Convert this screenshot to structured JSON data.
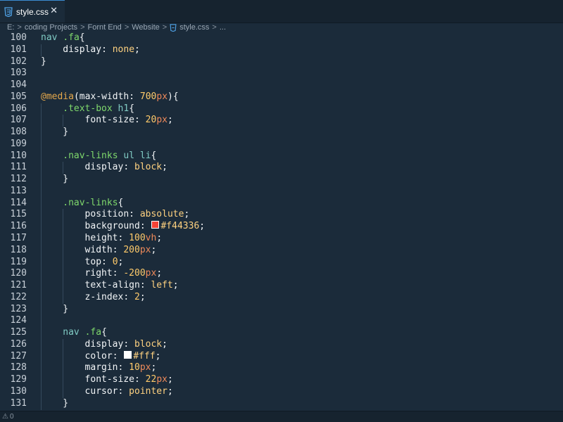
{
  "tab": {
    "label": "style.css",
    "close_glyph": "✕",
    "icon": "css3-icon"
  },
  "breadcrumb": {
    "items": [
      "E:",
      "coding Projects",
      "Fornt End",
      "Website",
      "style.css",
      "..."
    ],
    "separator": ">"
  },
  "status": {
    "problems_icon": "⚠",
    "count": "0"
  },
  "colors": {
    "background": "#1b2b3a",
    "tab_accent": "#3b8bd1",
    "swatch_red": "#f44336",
    "swatch_white": "#fff"
  },
  "code": {
    "lines": [
      {
        "n": "100",
        "i": 0,
        "t": [
          [
            "nav ",
            "sel"
          ],
          [
            ".fa",
            "cls"
          ],
          [
            "{",
            "punc"
          ]
        ]
      },
      {
        "n": "101",
        "i": 1,
        "t": [
          [
            "display",
            "prop"
          ],
          [
            ": ",
            "punc"
          ],
          [
            "none",
            "val"
          ],
          [
            ";",
            "punc"
          ]
        ]
      },
      {
        "n": "102",
        "i": 0,
        "t": [
          [
            "}",
            "punc"
          ]
        ]
      },
      {
        "n": "103",
        "i": 0,
        "t": []
      },
      {
        "n": "104",
        "i": 0,
        "t": []
      },
      {
        "n": "105",
        "i": 0,
        "t": [
          [
            "@media",
            "at"
          ],
          [
            "(",
            "punc"
          ],
          [
            "max-width",
            "prop"
          ],
          [
            ": ",
            "punc"
          ],
          [
            "700",
            "num"
          ],
          [
            "px",
            "unit"
          ],
          [
            "){",
            "punc"
          ]
        ]
      },
      {
        "n": "106",
        "i": 1,
        "t": [
          [
            ".text-box",
            "cls"
          ],
          [
            " h1",
            "sel"
          ],
          [
            "{",
            "punc"
          ]
        ]
      },
      {
        "n": "107",
        "i": 2,
        "t": [
          [
            "font-size",
            "prop"
          ],
          [
            ": ",
            "punc"
          ],
          [
            "20",
            "num"
          ],
          [
            "px",
            "unit"
          ],
          [
            ";",
            "punc"
          ]
        ]
      },
      {
        "n": "108",
        "i": 1,
        "t": [
          [
            "}",
            "punc"
          ]
        ]
      },
      {
        "n": "109",
        "i": 1,
        "t": []
      },
      {
        "n": "110",
        "i": 1,
        "t": [
          [
            ".nav-links",
            "cls"
          ],
          [
            " ul li",
            "sel"
          ],
          [
            "{",
            "punc"
          ]
        ]
      },
      {
        "n": "111",
        "i": 2,
        "t": [
          [
            "display",
            "prop"
          ],
          [
            ": ",
            "punc"
          ],
          [
            "block",
            "val"
          ],
          [
            ";",
            "punc"
          ]
        ]
      },
      {
        "n": "112",
        "i": 1,
        "t": [
          [
            "}",
            "punc"
          ]
        ]
      },
      {
        "n": "113",
        "i": 1,
        "t": []
      },
      {
        "n": "114",
        "i": 1,
        "t": [
          [
            ".nav-links",
            "cls"
          ],
          [
            "{",
            "punc"
          ]
        ]
      },
      {
        "n": "115",
        "i": 2,
        "t": [
          [
            "position",
            "prop"
          ],
          [
            ": ",
            "punc"
          ],
          [
            "absolute",
            "val"
          ],
          [
            ";",
            "punc"
          ]
        ]
      },
      {
        "n": "116",
        "i": 2,
        "t": [
          [
            "background",
            "prop"
          ],
          [
            ": ",
            "punc"
          ],
          [
            "#f44336",
            "swatch"
          ],
          [
            "#f44336",
            "val"
          ],
          [
            ";",
            "punc"
          ]
        ]
      },
      {
        "n": "117",
        "i": 2,
        "t": [
          [
            "height",
            "prop"
          ],
          [
            ": ",
            "punc"
          ],
          [
            "100",
            "num"
          ],
          [
            "vh",
            "unit"
          ],
          [
            ";",
            "punc"
          ]
        ]
      },
      {
        "n": "118",
        "i": 2,
        "t": [
          [
            "width",
            "prop"
          ],
          [
            ": ",
            "punc"
          ],
          [
            "200",
            "num"
          ],
          [
            "px",
            "unit"
          ],
          [
            ";",
            "punc"
          ]
        ]
      },
      {
        "n": "119",
        "i": 2,
        "t": [
          [
            "top",
            "prop"
          ],
          [
            ": ",
            "punc"
          ],
          [
            "0",
            "num"
          ],
          [
            ";",
            "punc"
          ]
        ]
      },
      {
        "n": "120",
        "i": 2,
        "t": [
          [
            "right",
            "prop"
          ],
          [
            ": ",
            "punc"
          ],
          [
            "-200",
            "num"
          ],
          [
            "px",
            "unit"
          ],
          [
            ";",
            "punc"
          ]
        ]
      },
      {
        "n": "121",
        "i": 2,
        "t": [
          [
            "text-align",
            "prop"
          ],
          [
            ": ",
            "punc"
          ],
          [
            "left",
            "val"
          ],
          [
            ";",
            "punc"
          ]
        ]
      },
      {
        "n": "122",
        "i": 2,
        "t": [
          [
            "z-index",
            "prop"
          ],
          [
            ": ",
            "punc"
          ],
          [
            "2",
            "num"
          ],
          [
            ";",
            "punc"
          ]
        ]
      },
      {
        "n": "123",
        "i": 1,
        "t": [
          [
            "}",
            "punc"
          ]
        ]
      },
      {
        "n": "124",
        "i": 1,
        "t": []
      },
      {
        "n": "125",
        "i": 1,
        "t": [
          [
            "nav ",
            "sel"
          ],
          [
            ".fa",
            "cls"
          ],
          [
            "{",
            "punc"
          ]
        ]
      },
      {
        "n": "126",
        "i": 2,
        "t": [
          [
            "display",
            "prop"
          ],
          [
            ": ",
            "punc"
          ],
          [
            "block",
            "val"
          ],
          [
            ";",
            "punc"
          ]
        ]
      },
      {
        "n": "127",
        "i": 2,
        "t": [
          [
            "color",
            "prop"
          ],
          [
            ": ",
            "punc"
          ],
          [
            "#fff",
            "swatch"
          ],
          [
            "#fff",
            "val"
          ],
          [
            ";",
            "punc"
          ]
        ]
      },
      {
        "n": "128",
        "i": 2,
        "t": [
          [
            "margin",
            "prop"
          ],
          [
            ": ",
            "punc"
          ],
          [
            "10",
            "num"
          ],
          [
            "px",
            "unit"
          ],
          [
            ";",
            "punc"
          ]
        ]
      },
      {
        "n": "129",
        "i": 2,
        "t": [
          [
            "font-size",
            "prop"
          ],
          [
            ": ",
            "punc"
          ],
          [
            "22",
            "num"
          ],
          [
            "px",
            "unit"
          ],
          [
            ";",
            "punc"
          ]
        ]
      },
      {
        "n": "130",
        "i": 2,
        "t": [
          [
            "cursor",
            "prop"
          ],
          [
            ": ",
            "punc"
          ],
          [
            "pointer",
            "val"
          ],
          [
            ";",
            "punc"
          ]
        ]
      },
      {
        "n": "131",
        "i": 1,
        "t": [
          [
            "}",
            "punc"
          ]
        ]
      }
    ]
  }
}
